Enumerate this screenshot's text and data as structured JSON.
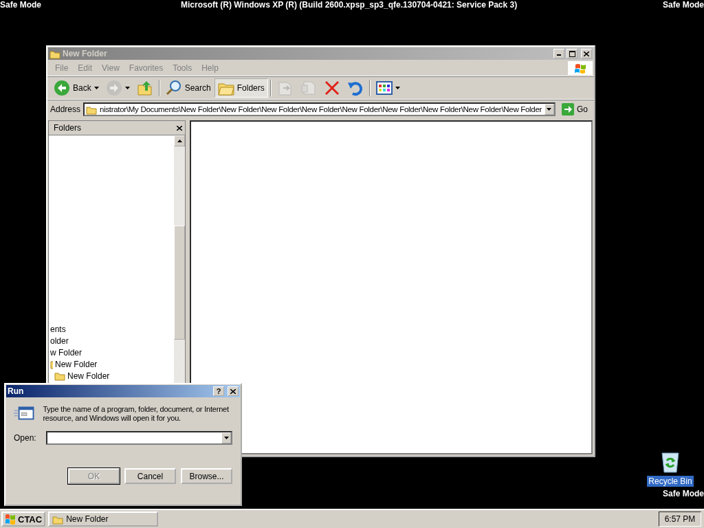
{
  "screen_text": {
    "top_left": "Safe Mode",
    "top_center": "Microsoft (R) Windows XP (R) (Build 2600.xpsp_sp3_qfe.130704-0421: Service Pack 3)",
    "top_right": "Safe Mode",
    "bottom_right": "Safe Mode"
  },
  "explorer": {
    "title": "New Folder",
    "active": false,
    "menu": [
      "File",
      "Edit",
      "View",
      "Favorites",
      "Tools",
      "Help"
    ],
    "toolbar": [
      {
        "kind": "back",
        "label": "Back",
        "disabled": false,
        "pressed": false
      },
      {
        "kind": "forward",
        "disabled": true,
        "pressed": false
      },
      {
        "kind": "up",
        "disabled": false,
        "pressed": false
      },
      {
        "kind": "search",
        "label": "Search",
        "disabled": false,
        "pressed": false
      },
      {
        "kind": "folders",
        "label": "Folders",
        "disabled": false,
        "pressed": true
      },
      {
        "kind": "move",
        "disabled": true,
        "pressed": false
      },
      {
        "kind": "copy",
        "disabled": true,
        "pressed": false
      },
      {
        "kind": "delete",
        "disabled": false,
        "pressed": false
      },
      {
        "kind": "undo",
        "disabled": false,
        "pressed": false
      },
      {
        "kind": "views",
        "disabled": false,
        "pressed": false
      }
    ],
    "address": {
      "label": "Address",
      "value": "nistrator\\My Documents\\New Folder\\New Folder\\New Folder\\New Folder\\New Folder\\New Folder\\New Folder\\New Folder\\New Folder",
      "go": "Go"
    },
    "folders_pane": {
      "title": "Folders",
      "tree": [
        {
          "label": "ents",
          "children": [
            {
              "label": "older",
              "children": [
                {
                  "label": "w Folder",
                  "children": [
                    {
                      "label": "New Folder",
                      "children": [
                        {
                          "label": "New Folder"
                        }
                      ]
                    }
                  ]
                }
              ]
            }
          ]
        }
      ]
    }
  },
  "run_dialog": {
    "title": "Run",
    "active": true,
    "help": "?",
    "message": "Type the name of a program, folder, document, or Internet resource, and Windows will open it for you.",
    "open_label": "Open:",
    "buttons": [
      {
        "label": "OK",
        "disabled": true
      },
      {
        "label": "Cancel",
        "disabled": false
      },
      {
        "label": "Browse...",
        "disabled": false
      }
    ]
  },
  "desktop_icons": [
    {
      "label": "Recycle Bin",
      "selected": true
    }
  ],
  "taskbar": {
    "start": "CTAC",
    "tasks": [
      {
        "label": "New Folder",
        "selected": false
      }
    ],
    "clock": "6:57 PM"
  }
}
